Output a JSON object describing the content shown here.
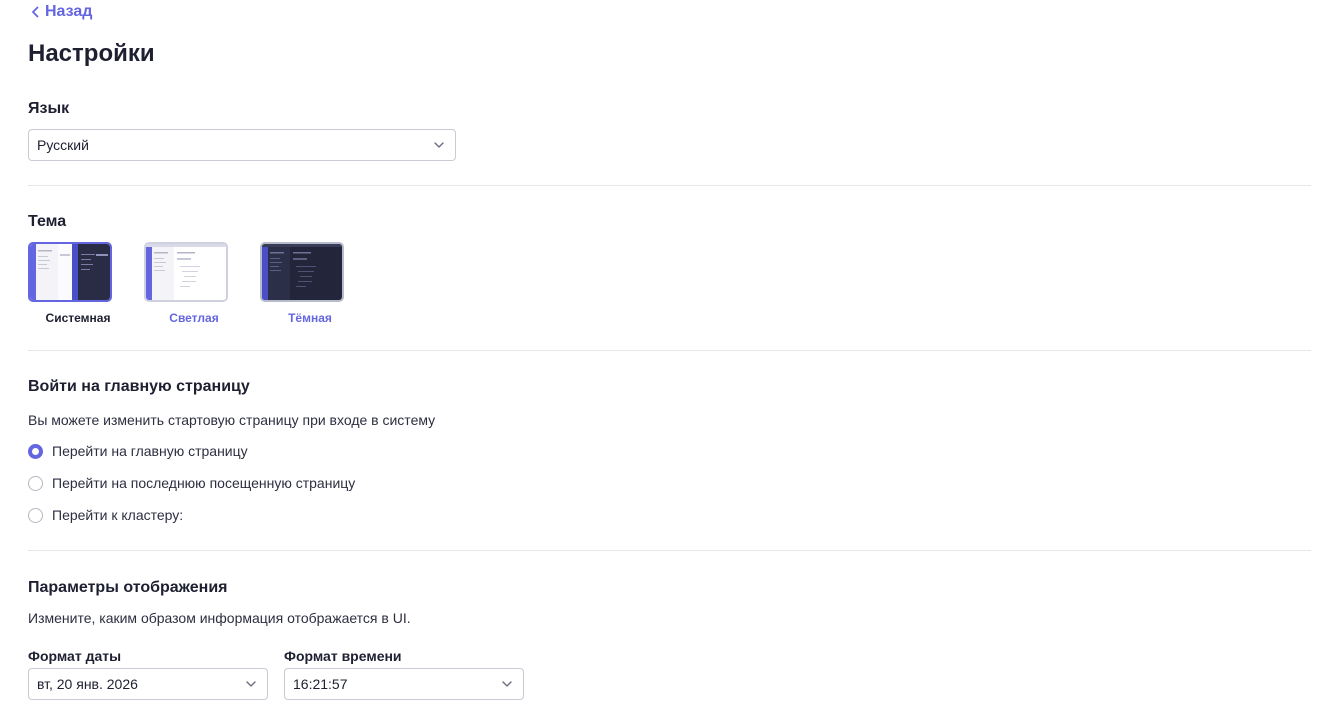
{
  "nav": {
    "back_label": "Назад"
  },
  "page": {
    "title": "Настройки"
  },
  "language": {
    "title": "Язык",
    "selected": "Русский"
  },
  "theme": {
    "title": "Тема",
    "options": [
      {
        "label": "Системная",
        "state": "selected"
      },
      {
        "label": "Светлая",
        "state": "option"
      },
      {
        "label": "Тёмная",
        "state": "option"
      }
    ]
  },
  "start_page": {
    "title": "Войти на главную страницу",
    "description": "Вы можете изменить стартовую страницу при входе в систему",
    "options": [
      {
        "label": "Перейти на главную страницу",
        "checked": true
      },
      {
        "label": "Перейти на последнюю посещенную страницу",
        "checked": false
      },
      {
        "label": "Перейти к кластеру:",
        "checked": false
      }
    ]
  },
  "display": {
    "title": "Параметры отображения",
    "description": "Измените, каким образом информация отображается в UI.",
    "date_format": {
      "label": "Формат даты",
      "value": "вт, 20 янв. 2026"
    },
    "time_format": {
      "label": "Формат времени",
      "value": "16:21:57"
    }
  },
  "colors": {
    "accent": "#6466e1",
    "text": "#1e2032",
    "border": "#c9cbd4"
  },
  "icons": {
    "back": "chevron-left-icon",
    "dropdown": "chevron-down-icon"
  }
}
